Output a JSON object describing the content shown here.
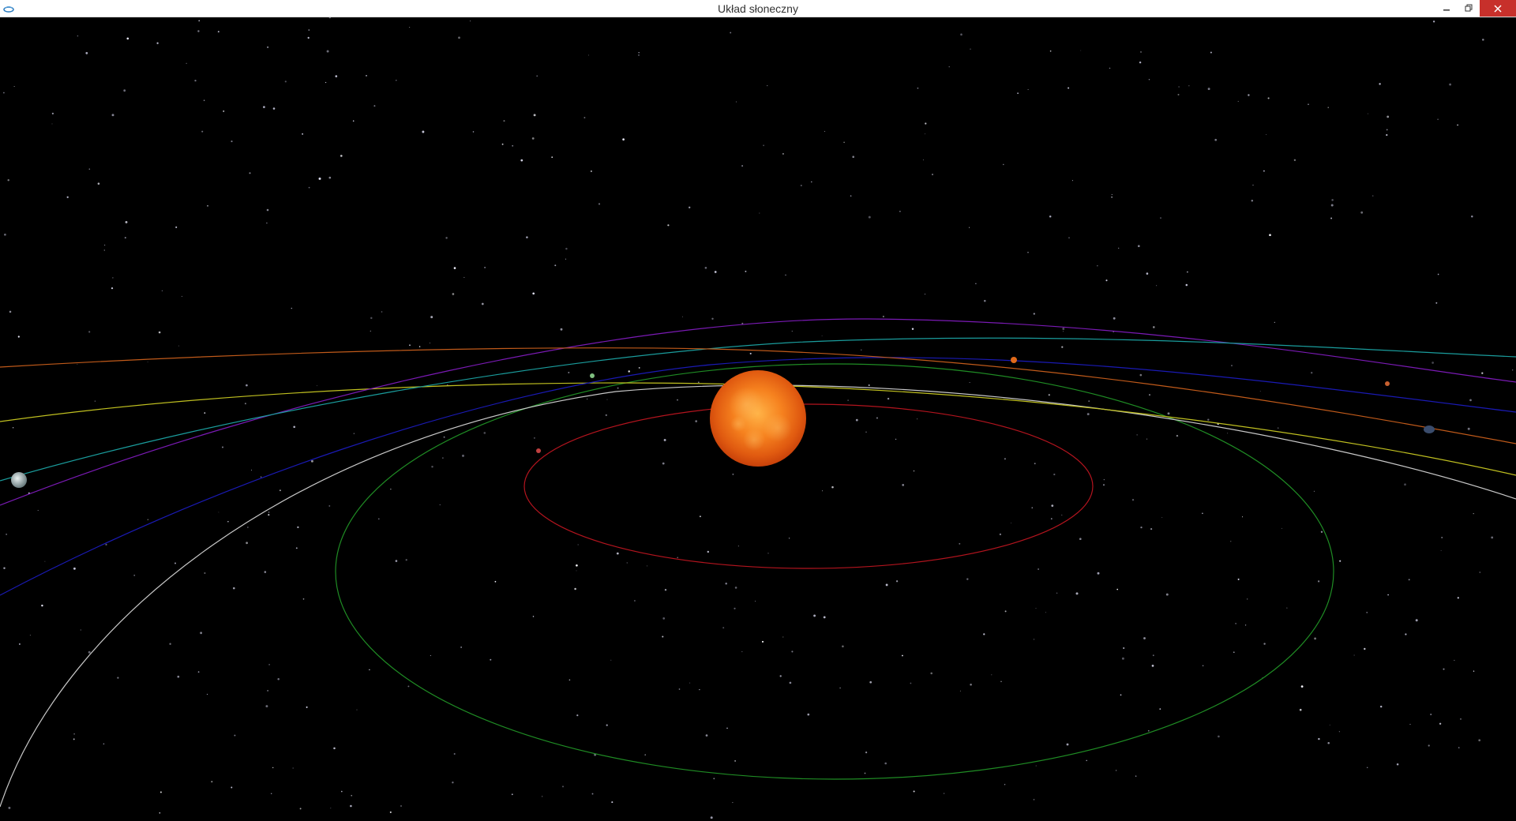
{
  "window": {
    "title": "Układ słoneczny",
    "app_icon": "opengl-window-icon",
    "controls": {
      "minimize_icon": "minimize-icon",
      "maximize_icon": "restore-icon",
      "close_icon": "close-icon"
    }
  },
  "scene": {
    "background_color": "#000000",
    "sun_color": "#f07a1a",
    "orbit_colors": {
      "mercury": "#b3141e",
      "venus": "#1f8c24",
      "earth": "#c8c8c8",
      "mars": "#c0c020",
      "jupiter": "#1a1ab4",
      "saturn": "#7a1ab4",
      "uranus": "#1a9c9c",
      "neptune": "#c05a1a"
    }
  }
}
